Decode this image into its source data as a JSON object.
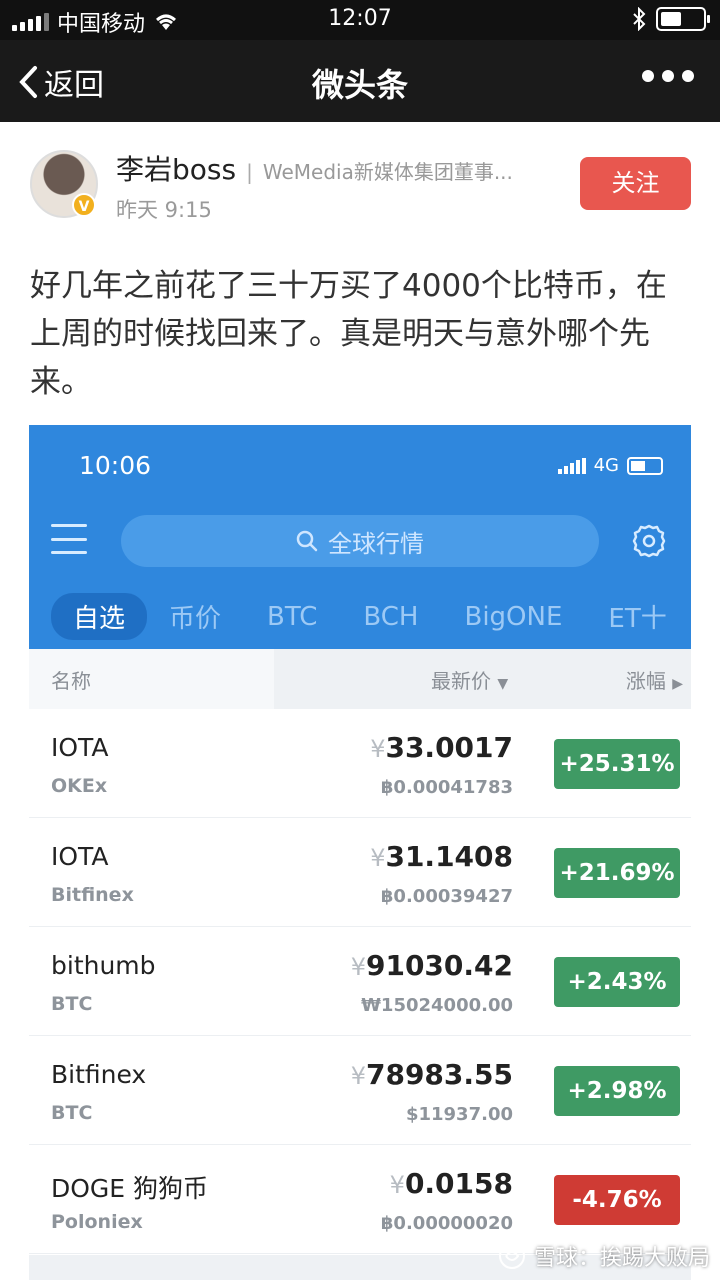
{
  "status_bar": {
    "carrier": "中国移动",
    "time": "12:07"
  },
  "nav": {
    "back_label": "返回",
    "title": "微头条"
  },
  "post": {
    "author_name": "李岩boss",
    "author_title": "WeMedia新媒体集团董事...",
    "time": "昨天 9:15",
    "follow_label": "关注",
    "text": "好几年之前花了三十万买了4000个比特币，在上周的时候找回来了。真是明天与意外哪个先来。"
  },
  "embedded": {
    "time": "10:06",
    "network": "4G",
    "search_placeholder": "全球行情",
    "tabs": [
      "自选",
      "币价",
      "BTC",
      "BCH",
      "BigONE",
      "ET十"
    ],
    "columns": {
      "name": "名称",
      "price": "最新价",
      "change": "涨幅"
    },
    "rows": [
      {
        "name": "IOTA",
        "exchange": "OKEx",
        "currency": "¥",
        "price": "33.0017",
        "sub": "฿0.00041783",
        "change": "+25.31%",
        "direction": "up"
      },
      {
        "name": "IOTA",
        "exchange": "Bitfinex",
        "currency": "¥",
        "price": "31.1408",
        "sub": "฿0.00039427",
        "change": "+21.69%",
        "direction": "up"
      },
      {
        "name": "bithumb",
        "exchange": "BTC",
        "currency": "¥",
        "price": "91030.42",
        "sub": "₩15024000.00",
        "change": "+2.43%",
        "direction": "up"
      },
      {
        "name": "Bitfinex",
        "exchange": "BTC",
        "currency": "¥",
        "price": "78983.55",
        "sub": "$11937.00",
        "change": "+2.98%",
        "direction": "up"
      },
      {
        "name": "DOGE 狗狗币",
        "exchange": "Poloniex",
        "currency": "¥",
        "price": "0.0158",
        "sub": "฿0.00000020",
        "change": "-4.76%",
        "direction": "down"
      }
    ]
  },
  "watermark": {
    "text": "雪球：挨踢大败局"
  },
  "colors": {
    "header_blue": "#2f87dd",
    "up_green": "#3f9a64",
    "down_red": "#cf3b34",
    "follow_red": "#e8574f"
  }
}
